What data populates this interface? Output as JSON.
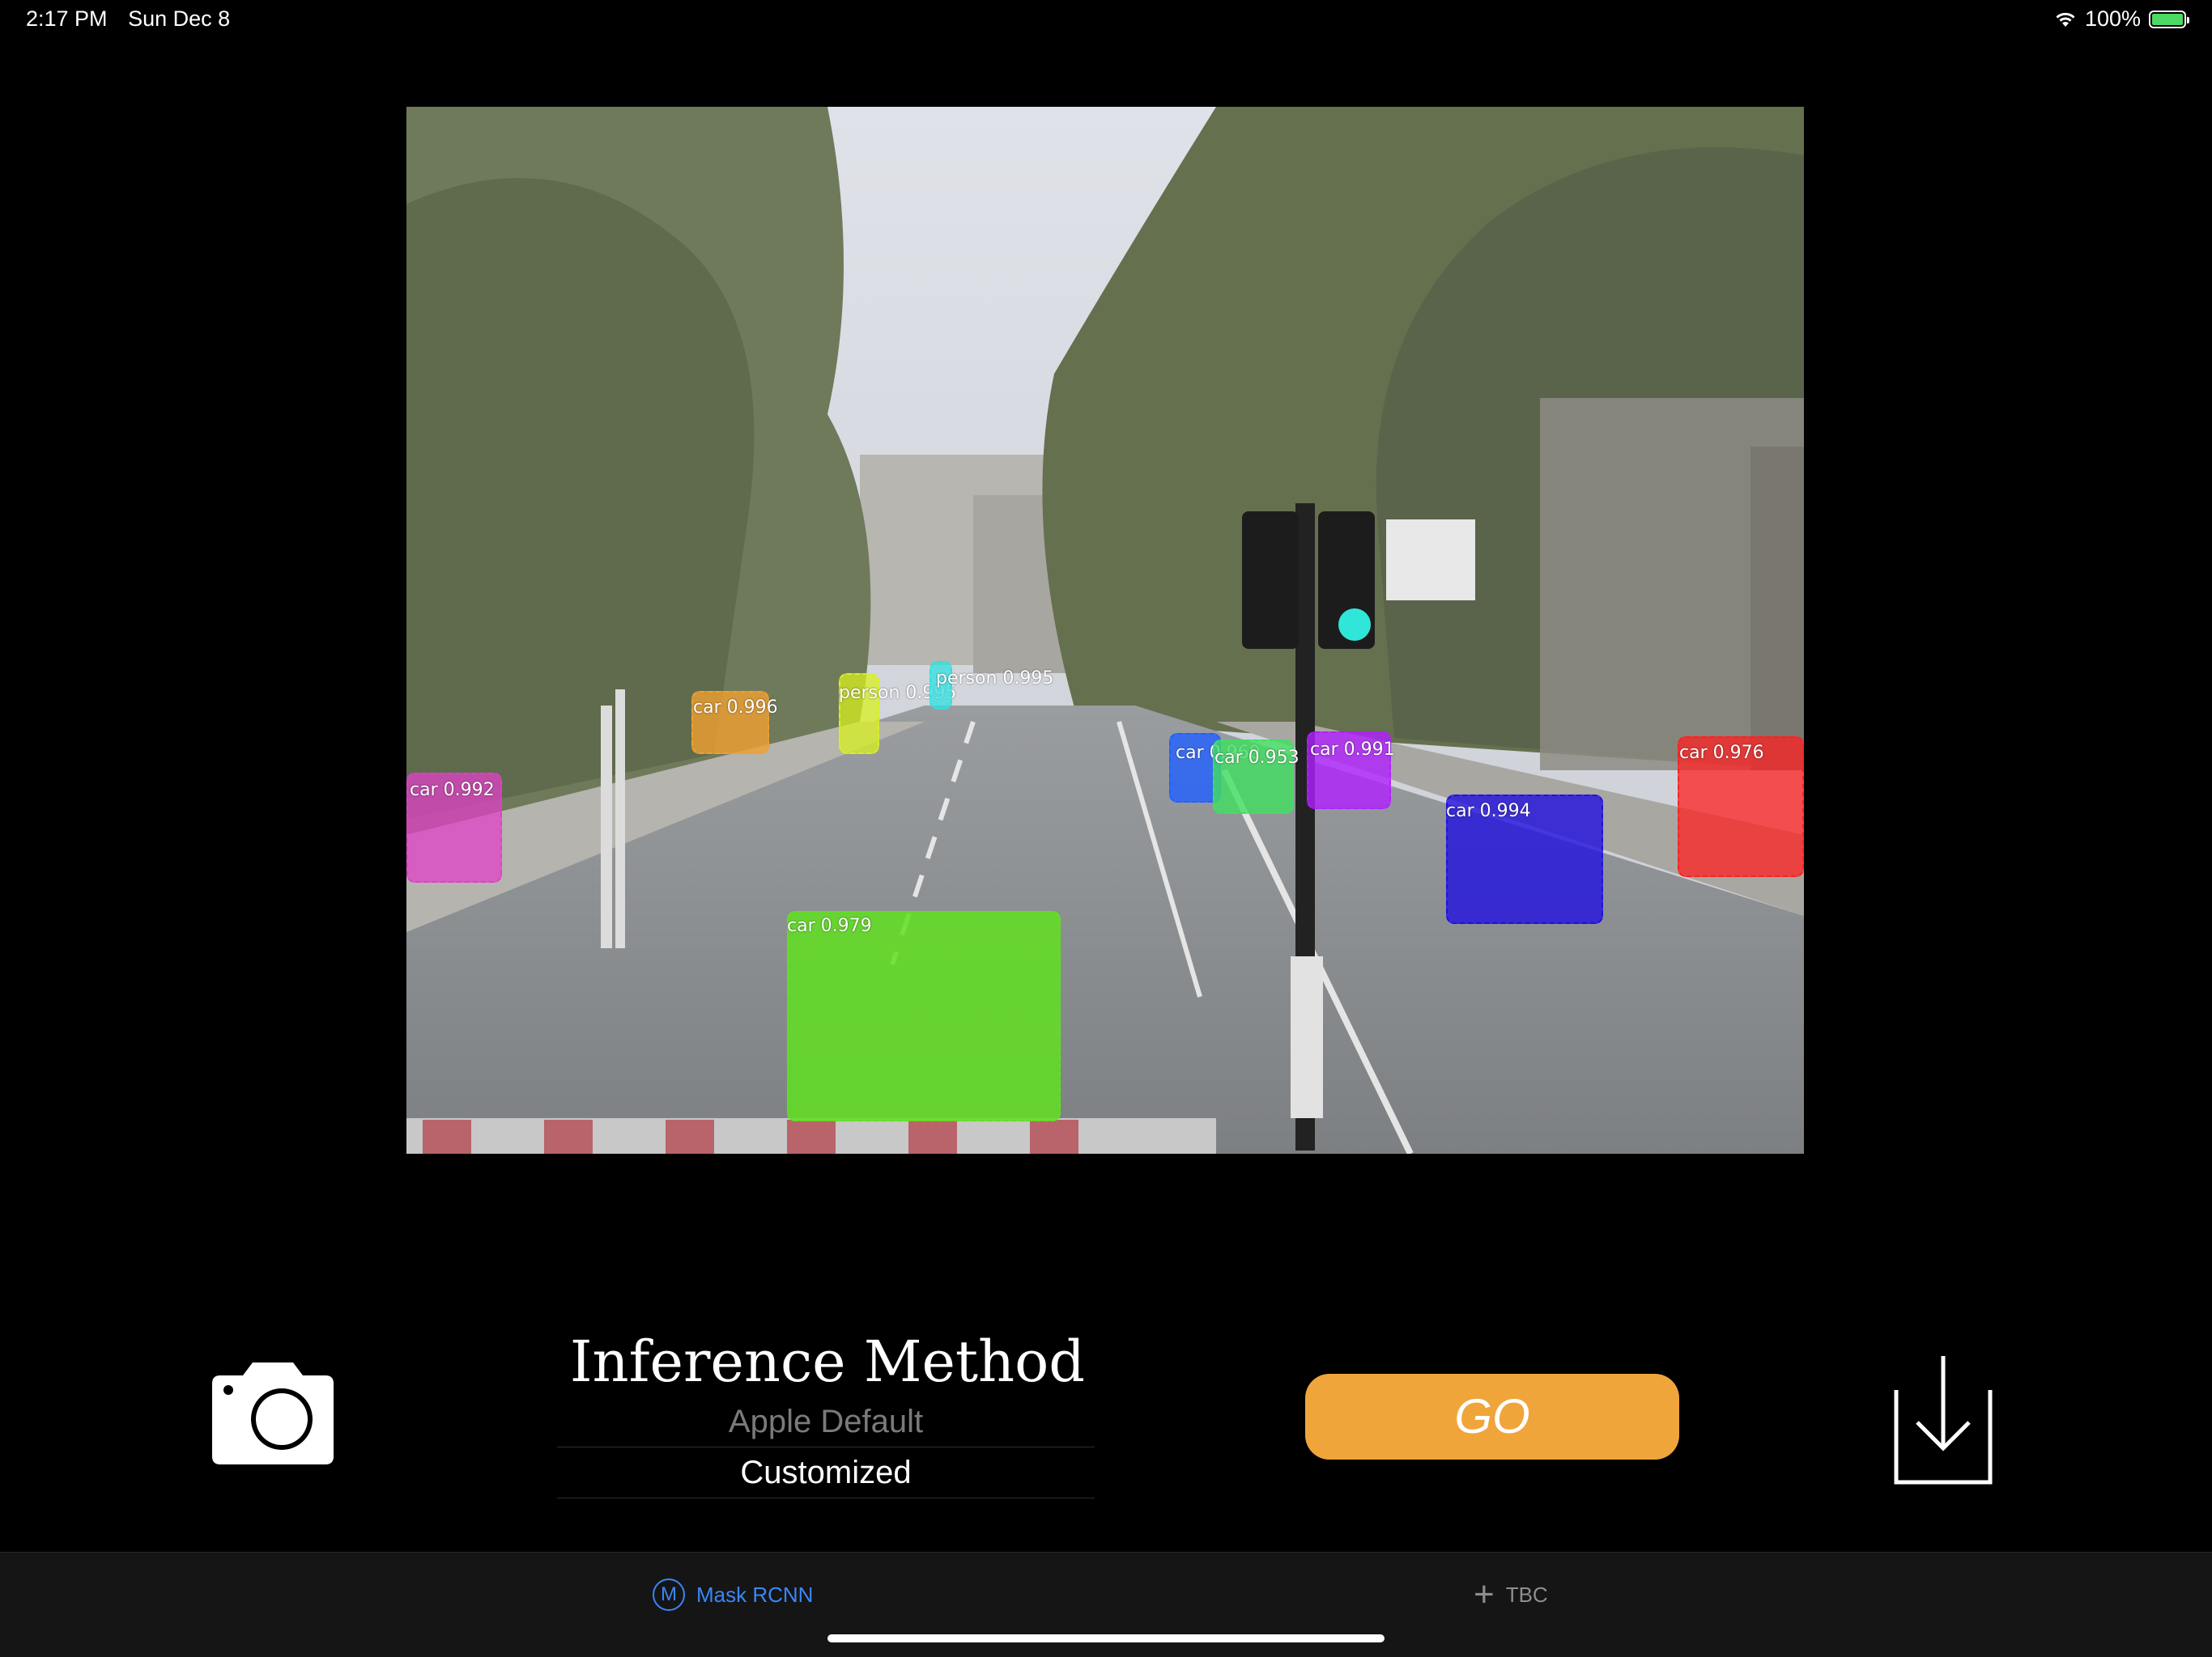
{
  "status_bar": {
    "time": "2:17 PM",
    "date": "Sun Dec 8",
    "battery": "100%",
    "battery_level": 1.0
  },
  "image": {
    "detections": [
      {
        "label": "car 0.992",
        "color": "#e040c8"
      },
      {
        "label": "car 0.996",
        "color": "#f0a030"
      },
      {
        "label": "person 0.995",
        "color": "#d8f020"
      },
      {
        "label": "person 0.995",
        "color": "#30e0e0"
      },
      {
        "label": "car 0.979",
        "color": "#60e020"
      },
      {
        "label": "car 0.960",
        "color": "#2060ff"
      },
      {
        "label": "car 0.953",
        "color": "#40e060"
      },
      {
        "label": "car 0.991",
        "color": "#b020ff"
      },
      {
        "label": "car 0.994",
        "color": "#2010e0"
      },
      {
        "label": "car 0.976",
        "color": "#ff2020"
      }
    ]
  },
  "controls": {
    "title": "Inference Method",
    "options": [
      "Apple Default",
      "Customized"
    ],
    "selected_option": "Customized",
    "go_label": "GO",
    "camera_icon": "camera-icon",
    "download_icon": "download-icon"
  },
  "tabbar": {
    "tabs": [
      {
        "label": "Mask RCNN",
        "icon": "mask-icon",
        "active": true
      },
      {
        "label": "TBC",
        "icon": "plus-icon",
        "active": false
      }
    ]
  }
}
